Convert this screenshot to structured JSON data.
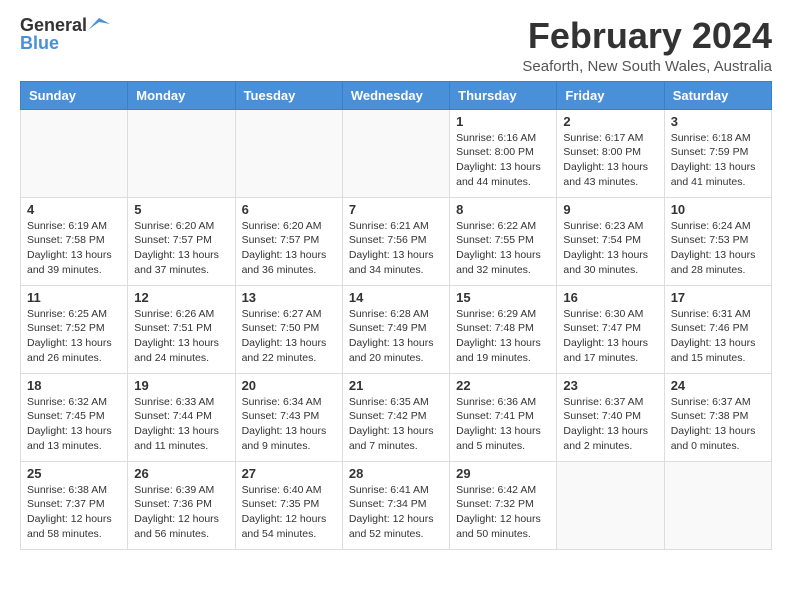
{
  "header": {
    "logo_general": "General",
    "logo_blue": "Blue",
    "title": "February 2024",
    "subtitle": "Seaforth, New South Wales, Australia"
  },
  "days_of_week": [
    "Sunday",
    "Monday",
    "Tuesday",
    "Wednesday",
    "Thursday",
    "Friday",
    "Saturday"
  ],
  "weeks": [
    [
      {
        "day": "",
        "info": ""
      },
      {
        "day": "",
        "info": ""
      },
      {
        "day": "",
        "info": ""
      },
      {
        "day": "",
        "info": ""
      },
      {
        "day": "1",
        "info": "Sunrise: 6:16 AM\nSunset: 8:00 PM\nDaylight: 13 hours\nand 44 minutes."
      },
      {
        "day": "2",
        "info": "Sunrise: 6:17 AM\nSunset: 8:00 PM\nDaylight: 13 hours\nand 43 minutes."
      },
      {
        "day": "3",
        "info": "Sunrise: 6:18 AM\nSunset: 7:59 PM\nDaylight: 13 hours\nand 41 minutes."
      }
    ],
    [
      {
        "day": "4",
        "info": "Sunrise: 6:19 AM\nSunset: 7:58 PM\nDaylight: 13 hours\nand 39 minutes."
      },
      {
        "day": "5",
        "info": "Sunrise: 6:20 AM\nSunset: 7:57 PM\nDaylight: 13 hours\nand 37 minutes."
      },
      {
        "day": "6",
        "info": "Sunrise: 6:20 AM\nSunset: 7:57 PM\nDaylight: 13 hours\nand 36 minutes."
      },
      {
        "day": "7",
        "info": "Sunrise: 6:21 AM\nSunset: 7:56 PM\nDaylight: 13 hours\nand 34 minutes."
      },
      {
        "day": "8",
        "info": "Sunrise: 6:22 AM\nSunset: 7:55 PM\nDaylight: 13 hours\nand 32 minutes."
      },
      {
        "day": "9",
        "info": "Sunrise: 6:23 AM\nSunset: 7:54 PM\nDaylight: 13 hours\nand 30 minutes."
      },
      {
        "day": "10",
        "info": "Sunrise: 6:24 AM\nSunset: 7:53 PM\nDaylight: 13 hours\nand 28 minutes."
      }
    ],
    [
      {
        "day": "11",
        "info": "Sunrise: 6:25 AM\nSunset: 7:52 PM\nDaylight: 13 hours\nand 26 minutes."
      },
      {
        "day": "12",
        "info": "Sunrise: 6:26 AM\nSunset: 7:51 PM\nDaylight: 13 hours\nand 24 minutes."
      },
      {
        "day": "13",
        "info": "Sunrise: 6:27 AM\nSunset: 7:50 PM\nDaylight: 13 hours\nand 22 minutes."
      },
      {
        "day": "14",
        "info": "Sunrise: 6:28 AM\nSunset: 7:49 PM\nDaylight: 13 hours\nand 20 minutes."
      },
      {
        "day": "15",
        "info": "Sunrise: 6:29 AM\nSunset: 7:48 PM\nDaylight: 13 hours\nand 19 minutes."
      },
      {
        "day": "16",
        "info": "Sunrise: 6:30 AM\nSunset: 7:47 PM\nDaylight: 13 hours\nand 17 minutes."
      },
      {
        "day": "17",
        "info": "Sunrise: 6:31 AM\nSunset: 7:46 PM\nDaylight: 13 hours\nand 15 minutes."
      }
    ],
    [
      {
        "day": "18",
        "info": "Sunrise: 6:32 AM\nSunset: 7:45 PM\nDaylight: 13 hours\nand 13 minutes."
      },
      {
        "day": "19",
        "info": "Sunrise: 6:33 AM\nSunset: 7:44 PM\nDaylight: 13 hours\nand 11 minutes."
      },
      {
        "day": "20",
        "info": "Sunrise: 6:34 AM\nSunset: 7:43 PM\nDaylight: 13 hours\nand 9 minutes."
      },
      {
        "day": "21",
        "info": "Sunrise: 6:35 AM\nSunset: 7:42 PM\nDaylight: 13 hours\nand 7 minutes."
      },
      {
        "day": "22",
        "info": "Sunrise: 6:36 AM\nSunset: 7:41 PM\nDaylight: 13 hours\nand 5 minutes."
      },
      {
        "day": "23",
        "info": "Sunrise: 6:37 AM\nSunset: 7:40 PM\nDaylight: 13 hours\nand 2 minutes."
      },
      {
        "day": "24",
        "info": "Sunrise: 6:37 AM\nSunset: 7:38 PM\nDaylight: 13 hours\nand 0 minutes."
      }
    ],
    [
      {
        "day": "25",
        "info": "Sunrise: 6:38 AM\nSunset: 7:37 PM\nDaylight: 12 hours\nand 58 minutes."
      },
      {
        "day": "26",
        "info": "Sunrise: 6:39 AM\nSunset: 7:36 PM\nDaylight: 12 hours\nand 56 minutes."
      },
      {
        "day": "27",
        "info": "Sunrise: 6:40 AM\nSunset: 7:35 PM\nDaylight: 12 hours\nand 54 minutes."
      },
      {
        "day": "28",
        "info": "Sunrise: 6:41 AM\nSunset: 7:34 PM\nDaylight: 12 hours\nand 52 minutes."
      },
      {
        "day": "29",
        "info": "Sunrise: 6:42 AM\nSunset: 7:32 PM\nDaylight: 12 hours\nand 50 minutes."
      },
      {
        "day": "",
        "info": ""
      },
      {
        "day": "",
        "info": ""
      }
    ]
  ]
}
